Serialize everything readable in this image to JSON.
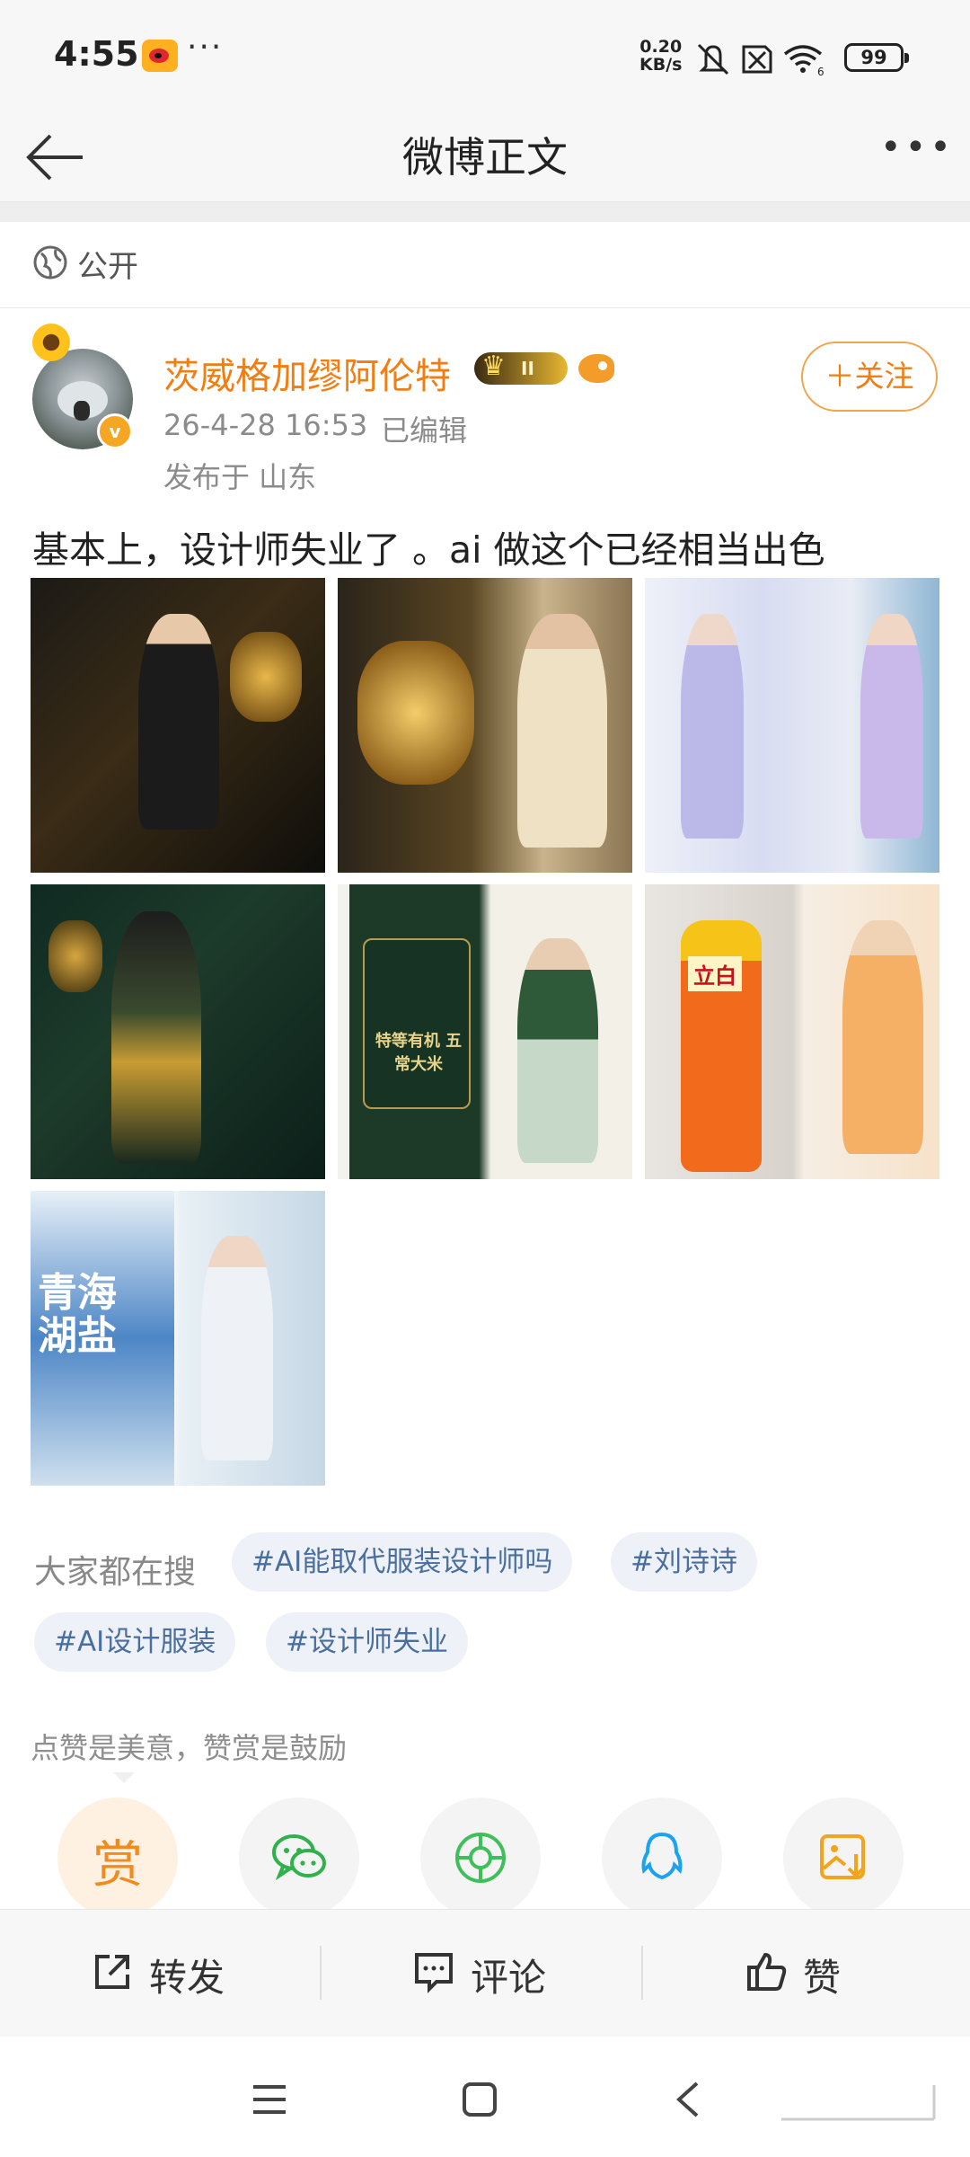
{
  "status_bar": {
    "time": "4:55",
    "more": "···",
    "speed_top": "0.20",
    "speed_bottom": "KB/s",
    "battery": "99"
  },
  "nav": {
    "title": "微博正文"
  },
  "visibility": {
    "label": "公开"
  },
  "author": {
    "name": "茨威格加缪阿伦特",
    "vip_level": "II",
    "timestamp": "26-4-28 16:53",
    "edited": "已编辑",
    "location": "发布于 山东",
    "follow_label": "＋关注"
  },
  "post": {
    "text": "基本上，设计师失业了 。ai 做这个已经相当出色",
    "image_texts": {
      "rice_bag": "特等有机 五常大米",
      "detergent": "立白",
      "salt_bag": "青海 湖盐"
    }
  },
  "trending": {
    "label": "大家都在搜",
    "tags": [
      "#AI能取代服装设计师吗",
      "#刘诗诗",
      "#AI设计服装",
      "#设计师失业"
    ]
  },
  "reward": {
    "hint": "点赞是美意，赞赏是鼓励",
    "reward_char": "赏"
  },
  "actions": {
    "repost": "转发",
    "comment": "评论",
    "like": "赞"
  },
  "colors": {
    "accent_orange": "#f27e12",
    "tag_blue": "#4a6f9f",
    "wechat_green": "#2fb14c",
    "moments_green": "#3fbf5a",
    "qq_blue": "#1aa3f0",
    "save_orange": "#f2a51c"
  },
  "icons": [
    "weibo-icon",
    "mute-icon",
    "sim-off-icon",
    "wifi-icon",
    "battery-icon",
    "back-arrow-icon",
    "more-icon",
    "globe-icon",
    "verified-icon",
    "vip-crown-icon",
    "fan-badge-icon",
    "wechat-icon",
    "moments-icon",
    "qq-icon",
    "save-image-icon",
    "repost-icon",
    "comment-icon",
    "like-icon",
    "menu-icon",
    "home-icon",
    "back-icon"
  ]
}
